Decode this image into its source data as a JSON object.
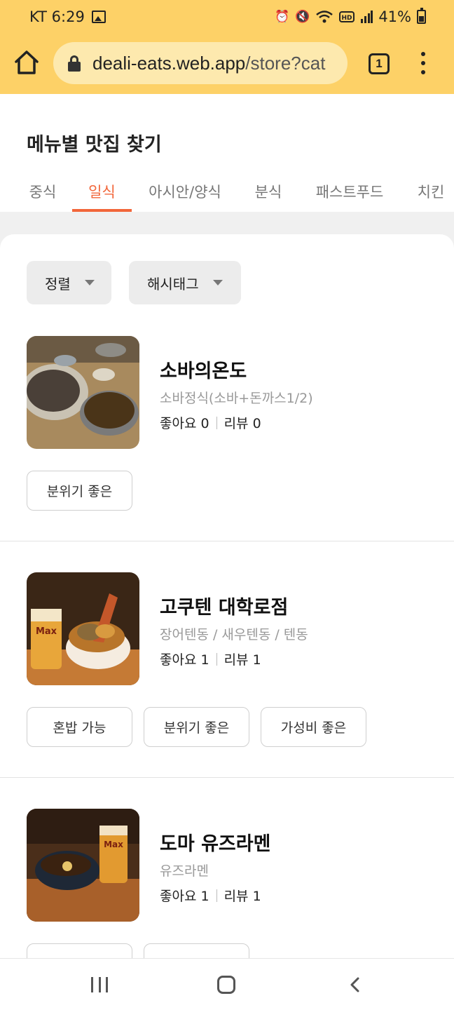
{
  "status_bar": {
    "carrier_time": "KT 6:29",
    "battery": "41%",
    "icons": [
      "gallery-icon",
      "alarm-icon",
      "mute-icon",
      "wifi-icon",
      "hd-icon",
      "signal-icon",
      "battery-icon"
    ]
  },
  "browser": {
    "url_domain": "deali-eats.web.app",
    "url_path": "/store?cat",
    "tab_count": "1"
  },
  "page": {
    "title": "메뉴별 맛집 찾기",
    "categories": [
      {
        "label": "중식",
        "active": false
      },
      {
        "label": "일식",
        "active": true
      },
      {
        "label": "아시안/양식",
        "active": false
      },
      {
        "label": "분식",
        "active": false
      },
      {
        "label": "패스트푸드",
        "active": false
      },
      {
        "label": "치킨",
        "active": false
      }
    ]
  },
  "filters": {
    "sort_label": "정렬",
    "hashtag_label": "해시태그"
  },
  "stores": [
    {
      "name": "소바의온도",
      "menu": "소바정식(소바+돈까스1/2)",
      "likes": "좋아요 0",
      "reviews": "리뷰 0",
      "tags": [
        "분위기 좋은"
      ]
    },
    {
      "name": "고쿠텐 대학로점",
      "menu": "장어텐동 / 새우텐동 / 텐동",
      "likes": "좋아요 1",
      "reviews": "리뷰 1",
      "tags": [
        "혼밥 가능",
        "분위기 좋은",
        "가성비 좋은"
      ]
    },
    {
      "name": "도마 유즈라멘",
      "menu": "유즈라멘",
      "likes": "좋아요 1",
      "reviews": "리뷰 1",
      "tags": [
        "",
        ""
      ]
    }
  ],
  "colors": {
    "chrome": "#fdd167",
    "accent": "#f2663a"
  }
}
